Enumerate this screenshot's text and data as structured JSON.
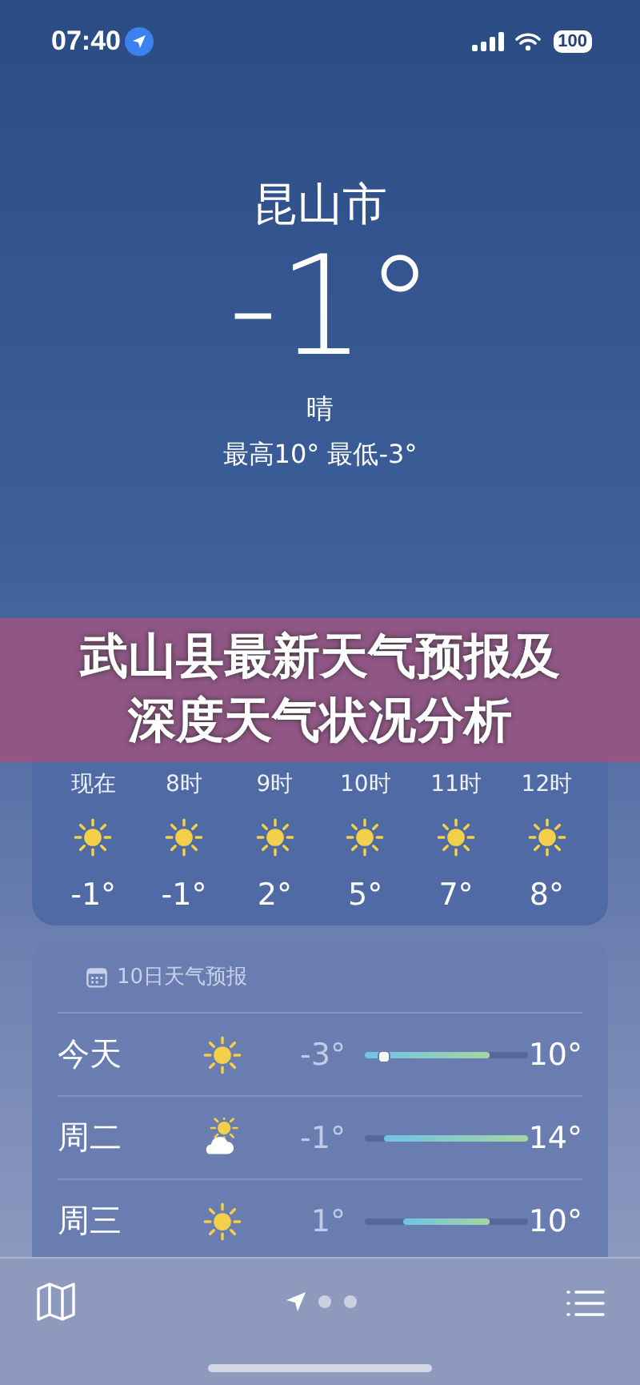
{
  "status_bar": {
    "time": "07:40",
    "battery": "100"
  },
  "location": {
    "city": "昆山市",
    "temperature": "-1°",
    "condition": "晴",
    "high_low": "最高10° 最低-3°"
  },
  "hourly": [
    {
      "time": "现在",
      "kind": "sun",
      "temp": "-1°"
    },
    {
      "time": "8时",
      "kind": "sun",
      "temp": "-1°"
    },
    {
      "time": "9时",
      "kind": "sun",
      "temp": "2°"
    },
    {
      "time": "10时",
      "kind": "sun",
      "temp": "5°"
    },
    {
      "time": "11时",
      "kind": "sun",
      "temp": "7°"
    },
    {
      "time": "12时",
      "kind": "sun",
      "temp": "8°"
    }
  ],
  "daily": {
    "title": "10日天气预报",
    "rows": [
      {
        "day": "今天",
        "kind": "sun",
        "low": "-3°",
        "high": "10°",
        "now_marker": true
      },
      {
        "day": "周二",
        "kind": "cloud-sun",
        "low": "-1°",
        "high": "14°",
        "now_marker": false
      },
      {
        "day": "周三",
        "kind": "sun",
        "low": "1°",
        "high": "10°",
        "now_marker": false
      }
    ]
  },
  "pages": [
    {
      "kind": "location",
      "selected": true
    },
    {
      "kind": "dot",
      "selected": false
    },
    {
      "kind": "dot",
      "selected": false
    }
  ],
  "banner": {
    "headline": "武山县最新天气预报及深度天气状况分析"
  }
}
